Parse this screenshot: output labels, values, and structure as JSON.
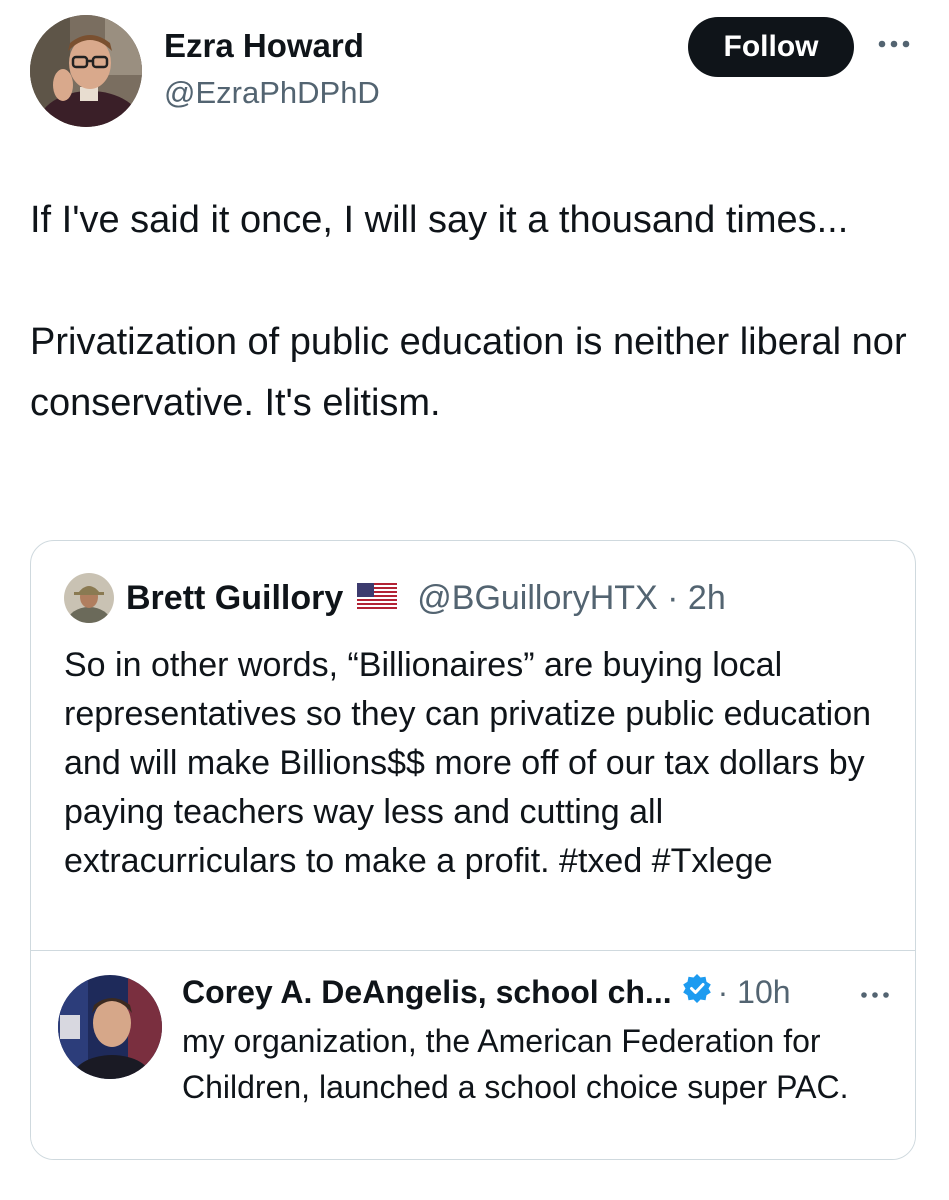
{
  "author": {
    "name": "Ezra Howard",
    "handle": "@EzraPhDPhD"
  },
  "follow_label": "Follow",
  "tweet_text": "If I've said it once, I will say it a thousand times...\n\nPrivatization of public education is neither liberal nor conservative. It's elitism.",
  "quote": {
    "name": "Brett Guillory",
    "flag_icon": "us-flag-icon",
    "handle_time": "@BGuilloryHTX · 2h",
    "text": "So in other words, “Billionaires” are buying local representatives so they can privatize public education and will make Billions$$ more off of our tax dollars by paying teachers way less and cutting all extracurriculars to make a profit. #txed #Txlege",
    "nested": {
      "name": "Corey A. DeAngelis, school ch...",
      "verified_icon": "verified-badge-icon",
      "time": "· 10h",
      "text": "my organization, the American Federation for Children, launched a school choice super PAC."
    }
  },
  "colors": {
    "text": "#0f1419",
    "secondary": "#536471",
    "border": "#cfd9de",
    "verified": "#1d9bf0",
    "button_bg": "#0f1419"
  }
}
